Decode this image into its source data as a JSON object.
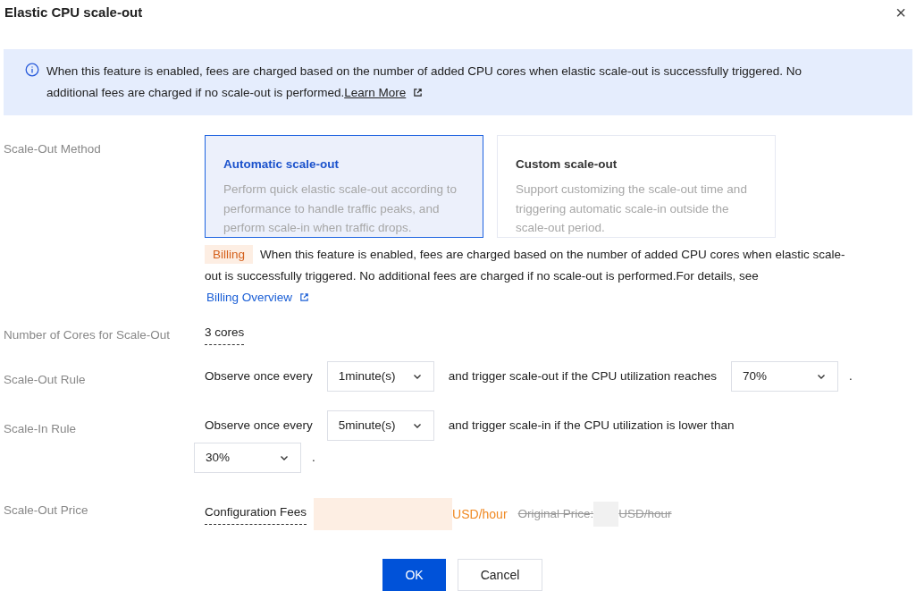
{
  "dialog": {
    "title": "Elastic CPU scale-out",
    "close": "×"
  },
  "notice": {
    "text": "When this feature is enabled, fees are charged based on the number of added CPU cores when elastic scale-out is successfully triggered. No additional fees are charged if no scale-out is performed.",
    "link": "Learn More"
  },
  "method": {
    "label": "Scale-Out Method",
    "options": [
      {
        "title": "Automatic scale-out",
        "description": "Perform quick elastic scale-out according to performance to handle traffic peaks, and perform scale-in when traffic drops.",
        "selected": true
      },
      {
        "title": "Custom scale-out",
        "description": "Support customizing the scale-out time and triggering automatic scale-in outside the scale-out period.",
        "selected": false
      }
    ],
    "billing_tag": "Billing",
    "billing_text": "When this feature is enabled, fees are charged based on the number of added CPU cores when elastic scale-out is successfully triggered. No additional fees are charged if no scale-out is performed.For details, see",
    "billing_link": "Billing Overview"
  },
  "cores": {
    "label": "Number of Cores for Scale-Out",
    "value": "3 cores"
  },
  "rules": [
    {
      "label": "Scale-Out Rule",
      "prefix": "Observe once every",
      "interval": "1minute(s)",
      "middle": "and trigger scale-out if the CPU utilization reaches",
      "threshold": "70%",
      "suffix": ".",
      "wrap": false
    },
    {
      "label": "Scale-In Rule",
      "prefix": "Observe once every",
      "interval": "5minute(s)",
      "middle": "and trigger scale-in if the CPU utilization is lower than",
      "threshold": "30%",
      "suffix": ".",
      "wrap": true
    }
  ],
  "price": {
    "label": "Scale-Out Price",
    "fee_label": "Configuration Fees",
    "unit": "USD/hour",
    "original_label": "Original Price:",
    "original_unit": "USD/hour"
  },
  "buttons": [
    {
      "label": "OK",
      "kind": "primary"
    },
    {
      "label": "Cancel",
      "kind": "secondary"
    }
  ]
}
